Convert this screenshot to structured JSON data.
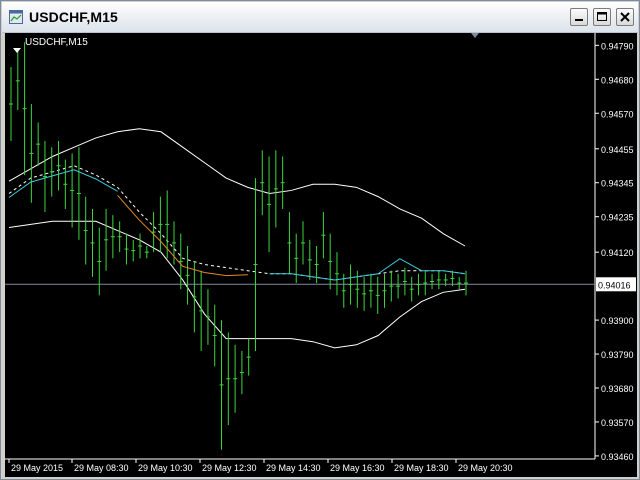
{
  "window": {
    "title": "USDCHF,M15"
  },
  "chart_label": "USDCHF,M15",
  "colors": {
    "background": "#000000",
    "axis": "#ffffff",
    "candle": "#3cd63c",
    "band": "#ffffff",
    "mid": "#ffffff",
    "cyan": "#3fc8d8",
    "orange": "#e08a2a",
    "current_line": "#7e8aa0"
  },
  "icons": [
    "chart-window-icon",
    "minimize-icon",
    "maximize-icon",
    "close-icon",
    "dropdown-arrow-icon"
  ],
  "chart_data": {
    "type": "line",
    "symbol": "USDCHF",
    "timeframe": "M15",
    "y_ticks": [
      "0.94790",
      "0.94680",
      "0.94570",
      "0.94455",
      "0.94345",
      "0.94235",
      "0.94120",
      "0.94016",
      "0.93900",
      "0.93790",
      "0.93680",
      "0.93570",
      "0.93460"
    ],
    "x_ticks": [
      "29 May 2015",
      "29 May 08:30",
      "29 May 10:30",
      "29 May 12:30",
      "29 May 14:30",
      "29 May 16:30",
      "29 May 18:30",
      "29 May 20:30"
    ],
    "current_price": "0.94016",
    "ylim": [
      0.9345,
      0.9483
    ],
    "series": [
      {
        "name": "",
        "style": "upper-band",
        "values": [
          0.9435,
          0.9439,
          0.9443,
          0.9446,
          0.9449,
          0.9451,
          0.9452,
          0.9451,
          0.9446,
          0.9441,
          0.9436,
          0.9433,
          0.9431,
          0.9432,
          0.9434,
          0.9434,
          0.9433,
          0.943,
          0.9426,
          0.9423,
          0.9418,
          0.9414
        ]
      },
      {
        "name": "",
        "style": "lower-band",
        "values": [
          0.942,
          0.9421,
          0.9422,
          0.9422,
          0.9422,
          0.9419,
          0.9416,
          0.9412,
          0.9403,
          0.9392,
          0.9384,
          0.9384,
          0.9384,
          0.9384,
          0.9383,
          0.9381,
          0.9382,
          0.9385,
          0.9391,
          0.9396,
          0.9399,
          0.94
        ]
      },
      {
        "name": "",
        "style": "middle",
        "values": [
          0.9431,
          0.9436,
          0.9438,
          0.944,
          0.9437,
          0.9433,
          0.9425,
          0.9418,
          0.941,
          0.9408,
          0.9407,
          0.9406,
          0.9405,
          0.9405,
          0.9404,
          0.9403,
          0.9404,
          0.9405,
          0.9406,
          0.9406,
          0.9406,
          0.9405
        ]
      }
    ],
    "candles": [
      {
        "h": 0.9472,
        "l": 0.9448
      },
      {
        "h": 0.9477,
        "l": 0.9458
      },
      {
        "h": 0.948,
        "l": 0.9437
      },
      {
        "h": 0.946,
        "l": 0.9428
      },
      {
        "h": 0.9454,
        "l": 0.944
      },
      {
        "h": 0.9448,
        "l": 0.9425
      },
      {
        "h": 0.9446,
        "l": 0.943
      },
      {
        "h": 0.9448,
        "l": 0.9432
      },
      {
        "h": 0.9442,
        "l": 0.9426
      },
      {
        "h": 0.9444,
        "l": 0.942
      },
      {
        "h": 0.9446,
        "l": 0.9416
      },
      {
        "h": 0.943,
        "l": 0.9408
      },
      {
        "h": 0.9426,
        "l": 0.9404
      },
      {
        "h": 0.942,
        "l": 0.9398
      },
      {
        "h": 0.9426,
        "l": 0.9406
      },
      {
        "h": 0.9424,
        "l": 0.941
      },
      {
        "h": 0.9422,
        "l": 0.9412
      },
      {
        "h": 0.9418,
        "l": 0.9408
      },
      {
        "h": 0.9416,
        "l": 0.9409
      },
      {
        "h": 0.9418,
        "l": 0.941
      },
      {
        "h": 0.9414,
        "l": 0.941
      },
      {
        "h": 0.9425,
        "l": 0.9412
      },
      {
        "h": 0.943,
        "l": 0.9412
      },
      {
        "h": 0.9432,
        "l": 0.941
      },
      {
        "h": 0.9422,
        "l": 0.9408
      },
      {
        "h": 0.9418,
        "l": 0.94
      },
      {
        "h": 0.9414,
        "l": 0.9395
      },
      {
        "h": 0.9409,
        "l": 0.9386
      },
      {
        "h": 0.9406,
        "l": 0.938
      },
      {
        "h": 0.94,
        "l": 0.9382
      },
      {
        "h": 0.9395,
        "l": 0.9375
      },
      {
        "h": 0.939,
        "l": 0.9348
      },
      {
        "h": 0.9386,
        "l": 0.9356
      },
      {
        "h": 0.9382,
        "l": 0.936
      },
      {
        "h": 0.938,
        "l": 0.9366
      },
      {
        "h": 0.9384,
        "l": 0.9372
      },
      {
        "h": 0.9436,
        "l": 0.938
      },
      {
        "h": 0.9445,
        "l": 0.9424
      },
      {
        "h": 0.9443,
        "l": 0.9412
      },
      {
        "h": 0.9445,
        "l": 0.942
      },
      {
        "h": 0.9443,
        "l": 0.9426
      },
      {
        "h": 0.9425,
        "l": 0.9405
      },
      {
        "h": 0.9418,
        "l": 0.9402
      },
      {
        "h": 0.9422,
        "l": 0.9408
      },
      {
        "h": 0.9416,
        "l": 0.9403
      },
      {
        "h": 0.9414,
        "l": 0.9402
      },
      {
        "h": 0.9425,
        "l": 0.941
      },
      {
        "h": 0.9418,
        "l": 0.94
      },
      {
        "h": 0.9412,
        "l": 0.9398
      },
      {
        "h": 0.9405,
        "l": 0.9394
      },
      {
        "h": 0.9408,
        "l": 0.9395
      },
      {
        "h": 0.9406,
        "l": 0.9394
      },
      {
        "h": 0.9404,
        "l": 0.9393
      },
      {
        "h": 0.9405,
        "l": 0.9394
      },
      {
        "h": 0.9404,
        "l": 0.9392
      },
      {
        "h": 0.9405,
        "l": 0.9394
      },
      {
        "h": 0.9406,
        "l": 0.9396
      },
      {
        "h": 0.9405,
        "l": 0.9397
      },
      {
        "h": 0.9407,
        "l": 0.9398
      },
      {
        "h": 0.9404,
        "l": 0.9396
      },
      {
        "h": 0.9405,
        "l": 0.9398
      },
      {
        "h": 0.9406,
        "l": 0.9398
      },
      {
        "h": 0.9405,
        "l": 0.94
      },
      {
        "h": 0.9406,
        "l": 0.94
      },
      {
        "h": 0.9405,
        "l": 0.9401
      },
      {
        "h": 0.9406,
        "l": 0.9401
      },
      {
        "h": 0.9404,
        "l": 0.94
      },
      {
        "h": 0.9406,
        "l": 0.9398
      }
    ]
  }
}
